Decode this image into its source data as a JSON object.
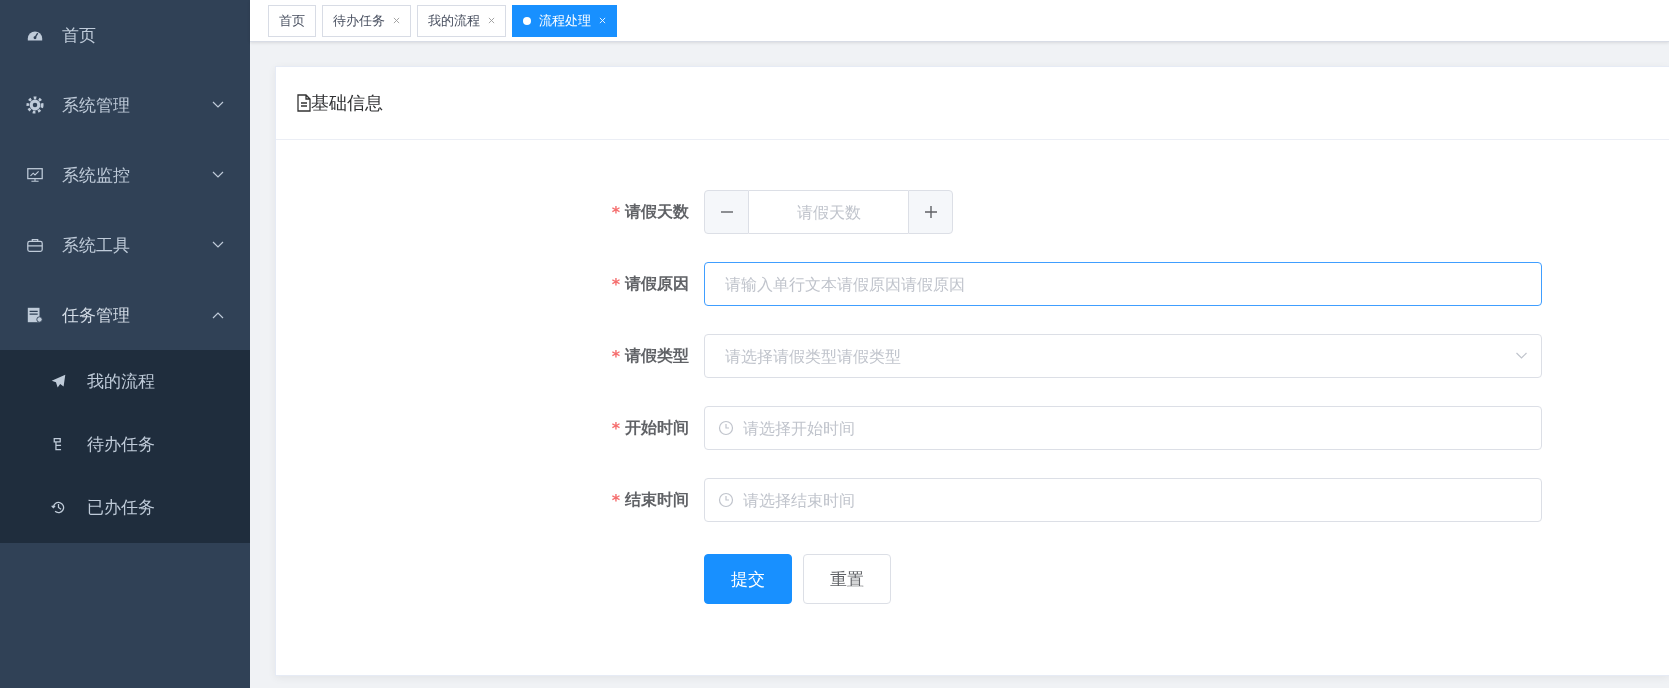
{
  "sidebar": {
    "items": [
      {
        "label": "首页",
        "has_children": false
      },
      {
        "label": "系统管理",
        "expanded": false,
        "has_children": true
      },
      {
        "label": "系统监控",
        "expanded": false,
        "has_children": true
      },
      {
        "label": "系统工具",
        "expanded": false,
        "has_children": true
      },
      {
        "label": "任务管理",
        "expanded": true,
        "has_children": true,
        "children": [
          {
            "label": "我的流程"
          },
          {
            "label": "待办任务"
          },
          {
            "label": "已办任务"
          }
        ]
      }
    ]
  },
  "tabs": [
    {
      "label": "首页",
      "selected": false,
      "closable": false
    },
    {
      "label": "待办任务",
      "selected": false,
      "closable": true
    },
    {
      "label": "我的流程",
      "selected": false,
      "closable": true
    },
    {
      "label": "流程处理",
      "selected": true,
      "closable": true
    }
  ],
  "card": {
    "title": "基础信息"
  },
  "form": {
    "fields": [
      {
        "kind": "number",
        "label": "请假天数",
        "required_mark": "*",
        "placeholder": "请假天数",
        "focused": false
      },
      {
        "kind": "text",
        "label": "请假原因",
        "required_mark": "*",
        "placeholder": "请输入单行文本请假原因请假原因",
        "focused": true
      },
      {
        "kind": "select",
        "label": "请假类型",
        "required_mark": "*",
        "placeholder": "请选择请假类型请假类型",
        "focused": false
      },
      {
        "kind": "datetime",
        "label": "开始时间",
        "required_mark": "*",
        "placeholder": "请选择开始时间",
        "focused": false
      },
      {
        "kind": "datetime",
        "label": "结束时间",
        "required_mark": "*",
        "placeholder": "请选择结束时间",
        "focused": false
      }
    ],
    "buttons": [
      {
        "label": "提交",
        "kind": "primary"
      },
      {
        "label": "重置",
        "kind": "default"
      }
    ]
  }
}
